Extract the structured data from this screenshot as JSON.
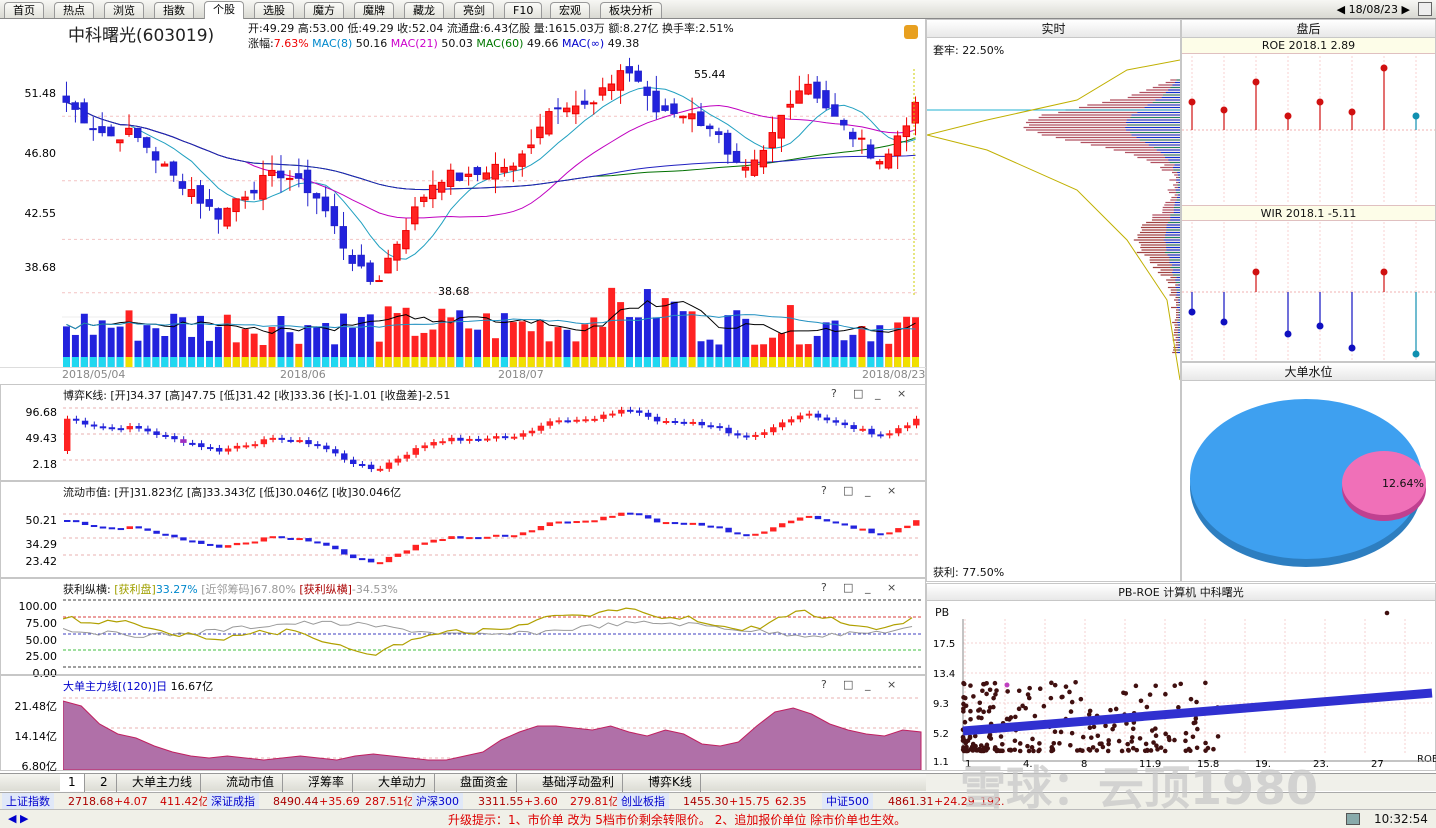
{
  "tabs": [
    "首页",
    "热点",
    "浏览",
    "指数",
    "个股",
    "选股",
    "魔方",
    "魔牌",
    "藏龙",
    "亮剑",
    "F10",
    "宏观",
    "板块分析"
  ],
  "active_tab": 4,
  "date": "18/08/23",
  "stock": {
    "name": "中科曙光",
    "code": "(603019)"
  },
  "quote": {
    "open_l": "开:",
    "open": "49.29",
    "high_l": "高:",
    "high": "53.00",
    "low_l": "低:",
    "low": "49.29",
    "close_l": "收:",
    "close": "52.04",
    "float_l": "流通盘:",
    "float": "6.43亿股",
    "vol_l": "量:",
    "vol": "1615.03万",
    "amt_l": "额:",
    "amt": "8.27亿",
    "turn_l": "换手率:",
    "turn": "2.51%"
  },
  "line2": {
    "chg_l": "涨幅:",
    "chg": "7.63%",
    "mac8_l": "MAC(8)",
    "mac8": "50.16",
    "mac21_l": "MAC(21)",
    "mac21": "50.03",
    "mac60_l": "MAC(60)",
    "mac60": "49.66",
    "macinf_l": "MAC(∞)",
    "macinf": "49.38"
  },
  "kline": {
    "y_ticks": [
      "51.48",
      "46.80",
      "42.55",
      "38.68"
    ],
    "y_values": [
      51.48,
      46.8,
      42.55,
      38.68
    ],
    "high_label": "55.44",
    "low_label": "38.68",
    "dates": [
      "2018/05/04",
      "2018/06",
      "2018/07",
      "2018/08/23"
    ]
  },
  "bo": {
    "title": "博弈K线:",
    "open_l": "[开]",
    "open": "34.37",
    "high_l": "[高]",
    "high": "47.75",
    "low_l": "[低]",
    "low": "31.42",
    "close_l": "[收]",
    "close": "33.36",
    "long_l": "[长]",
    "long": "-1.01",
    "diff_l": "[收盘差]",
    "diff": "-2.51",
    "y_ticks": [
      "96.68",
      "49.43",
      "2.18"
    ]
  },
  "ltsz": {
    "title": "流动市值:",
    "open_l": "[开]",
    "open": "31.823亿",
    "high_l": "[高]",
    "high": "33.343亿",
    "low_l": "[低]",
    "low": "30.046亿",
    "close_l": "[收]",
    "close": "30.046亿",
    "y_ticks": [
      "50.21",
      "34.29",
      "23.42"
    ]
  },
  "hlzh": {
    "title": "获利纵横:",
    "a_l": "[获利盘]",
    "a": "33.27%",
    "b_l": "[近邻筹码]",
    "b": "67.80%",
    "c_l": "[获利纵横]",
    "c": "-34.53%",
    "y_ticks": [
      "100.00",
      "75.00",
      "50.00",
      "25.00",
      "0.00"
    ]
  },
  "ddzl": {
    "title": "大单主力线[(120)]日",
    "val": "16.67亿",
    "y_ticks": [
      "21.48亿",
      "14.14亿",
      "6.80亿"
    ]
  },
  "panel_controls": [
    "?",
    "□",
    "_",
    "×"
  ],
  "realtime": {
    "title": "实时",
    "top_label": "套牢: 22.50%",
    "bottom_label": "获利: 77.50%"
  },
  "panhou": {
    "title": "盘后",
    "roe_title": "ROE 2018.1 2.89",
    "wir_title": "WIR 2018.1 -5.11"
  },
  "ddsw": {
    "title": "大单水位",
    "value": "12.64%",
    "value_num": 12.64
  },
  "pbroe": {
    "title": "PB-ROE 计算机 中科曙光",
    "pb_label": "PB",
    "roe_label": "ROE",
    "y_ticks": [
      "17.5",
      "13.4",
      "9.3",
      "5.2",
      "1.1"
    ],
    "x_ticks": [
      "1",
      "4.",
      "8",
      "11.9",
      "15.8",
      "19.",
      "23.",
      "27"
    ]
  },
  "bottom_tabs": [
    "1",
    "2",
    "大单主力线",
    "流动市值",
    "浮筹率",
    "大单动力",
    "盘面资金",
    "基础浮动盈利",
    "博弈K线"
  ],
  "indices": [
    {
      "name": "上证指数",
      "value": "2718.68",
      "chg": "+4.07",
      "amt": "411.42亿"
    },
    {
      "name": "深证成指",
      "value": "8490.44",
      "chg": "+35.69",
      "amt": "287.51亿"
    },
    {
      "name": "沪深300",
      "value": "3311.55",
      "chg": "+3.60",
      "amt": "279.81亿"
    },
    {
      "name": "创业板指",
      "value": "1455.30",
      "chg": "+15.75",
      "amt": "62.35"
    },
    {
      "name": "中证500",
      "value": "4861.31",
      "chg": "+24.29",
      "amt": "192."
    }
  ],
  "tip": "升级提示：1、市价单 改为 5档市价剩余转限价。 2、追加报价单位 除市价单也生效。",
  "clock": "10:32:54",
  "watermark": "雪球：云顶1980",
  "colors": {
    "up": "#e02020",
    "down": "#1a1ae0",
    "vol_low_up": "#f0e000",
    "vol_low_down": "#20d8f0"
  }
}
